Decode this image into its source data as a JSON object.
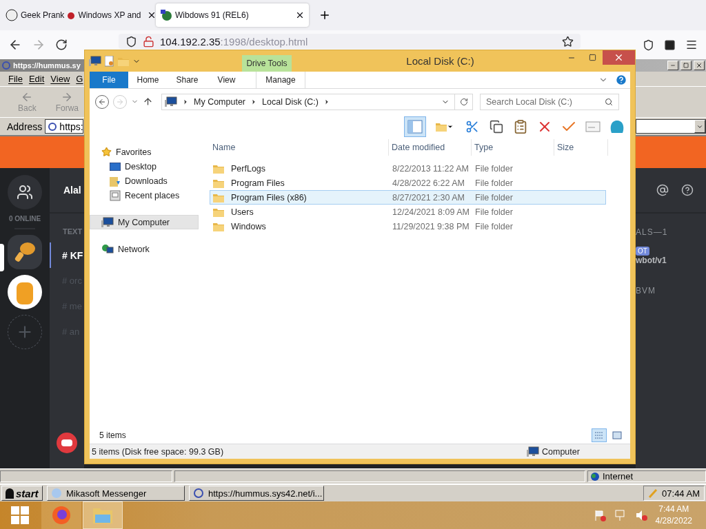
{
  "browser": {
    "tabs": [
      {
        "title": "Geek Prank",
        "title_rest": "Windows XP and",
        "selected": false
      },
      {
        "title": "Wibdows 91 (REL6)",
        "selected": true
      }
    ],
    "url": {
      "host": "104.192.2.35",
      "rest": ":1998/desktop.html"
    }
  },
  "ie": {
    "title": "https://hummus.sy",
    "menu": [
      "File",
      "Edit",
      "View",
      "G"
    ],
    "toolbar": [
      "Back",
      "Forwa"
    ],
    "address_label": "Address",
    "address": "https:",
    "status": "Internet"
  },
  "discord": {
    "online": "0 ONLINE",
    "servers": [
      {
        "selected": true
      },
      {
        "selected": false
      }
    ],
    "header": "Alal",
    "category": "TEXT",
    "channels": [
      {
        "name": "# KF",
        "selected": true
      },
      {
        "name": "# orc",
        "selected": false
      },
      {
        "name": "# me",
        "selected": false
      },
      {
        "name": "# an",
        "selected": false
      }
    ],
    "members_header": "ALS—1",
    "badge": "OT",
    "member": "wbot/v1",
    "group": "BVM"
  },
  "explorer": {
    "title": "Local Disk (C:)",
    "context_tab": "Drive Tools",
    "ribbon_tabs": [
      {
        "label": "File",
        "kind": "file",
        "selected": false
      },
      {
        "label": "Home",
        "kind": "tab",
        "selected": false
      },
      {
        "label": "Share",
        "kind": "tab",
        "selected": false
      },
      {
        "label": "View",
        "kind": "tab",
        "selected": false
      },
      {
        "label": "Manage",
        "kind": "context",
        "selected": false
      }
    ],
    "breadcrumb": [
      "My Computer",
      "Local Disk (C:)"
    ],
    "search": {
      "placeholder": "Search Local Disk (C:)"
    },
    "nav": [
      {
        "label": "Favorites",
        "selected": false,
        "children": [
          {
            "label": "Desktop",
            "selected": false
          },
          {
            "label": "Downloads",
            "selected": false
          },
          {
            "label": "Recent places",
            "selected": false
          }
        ]
      },
      {
        "label": "My Computer",
        "selected": true
      },
      {
        "label": "Network",
        "selected": false
      }
    ],
    "columns": [
      "Name",
      "Date modified",
      "Type",
      "Size"
    ],
    "rows": [
      {
        "name": "PerfLogs",
        "date": "8/22/2013 11:22 AM",
        "type": "File folder",
        "selected": false
      },
      {
        "name": "Program Files",
        "date": "4/28/2022 6:22 AM",
        "type": "File folder",
        "selected": false
      },
      {
        "name": "Program Files (x86)",
        "date": "8/27/2021 2:30 AM",
        "type": "File folder",
        "selected": true
      },
      {
        "name": "Users",
        "date": "12/24/2021 8:09 AM",
        "type": "File folder",
        "selected": false
      },
      {
        "name": "Windows",
        "date": "11/29/2021 9:38 PM",
        "type": "File folder",
        "selected": false
      }
    ],
    "item_count": "5 items",
    "views": [
      {
        "kind": "details",
        "selected": true
      },
      {
        "kind": "thumbnails",
        "selected": false
      }
    ],
    "status": "5 items (Disk free space: 99.3 GB)",
    "status_location": "Computer"
  },
  "xp_taskbar": {
    "start": "start",
    "tasks": [
      {
        "label": "Mikasoft Messenger",
        "kind": "messenger"
      },
      {
        "label": "https://hummus.sys42.net/i...",
        "kind": "browser"
      }
    ],
    "clock": "07:44 AM"
  },
  "win_taskbar": {
    "apps": [
      {
        "kind": "firefox",
        "selected": false
      },
      {
        "kind": "explorer",
        "selected": true
      }
    ],
    "time": "7:44 AM",
    "date": "4/28/2022"
  }
}
